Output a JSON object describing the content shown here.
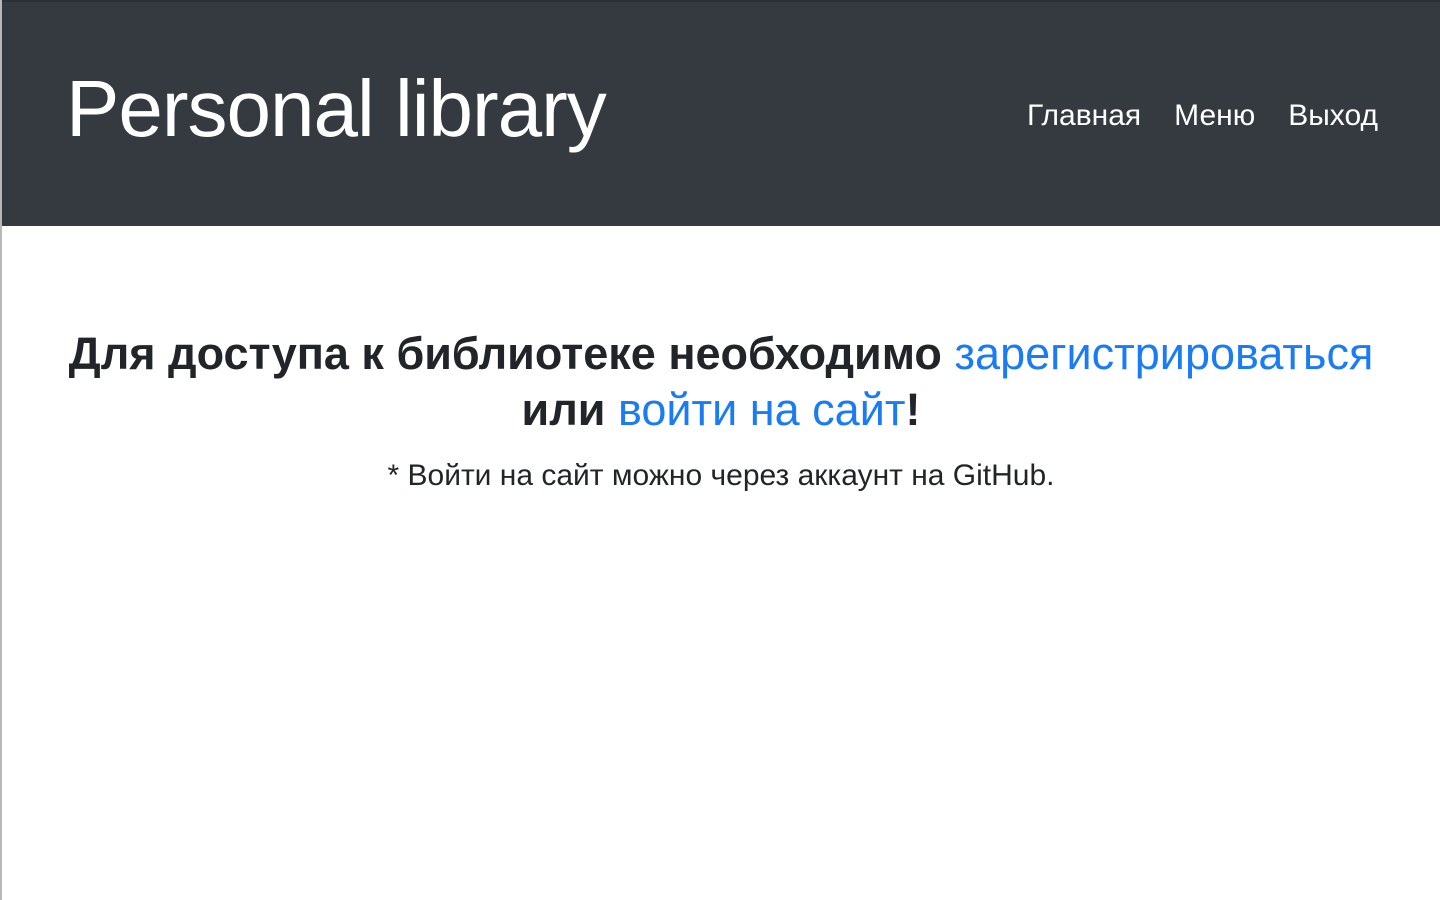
{
  "header": {
    "brand": "Personal library",
    "nav": [
      {
        "label": "Главная"
      },
      {
        "label": "Меню"
      },
      {
        "label": "Выход"
      }
    ]
  },
  "main": {
    "headline_prefix": "Для доступа к библиотеке необходимо ",
    "register_link": "зарегистрироваться",
    "headline_middle": "или ",
    "login_link": "войти на сайт",
    "headline_suffix": "!",
    "note": "* Войти на сайт можно через аккаунт на GitHub."
  },
  "colors": {
    "navbar_bg": "#343a40",
    "link": "#1a7cf5",
    "text": "#212529"
  }
}
